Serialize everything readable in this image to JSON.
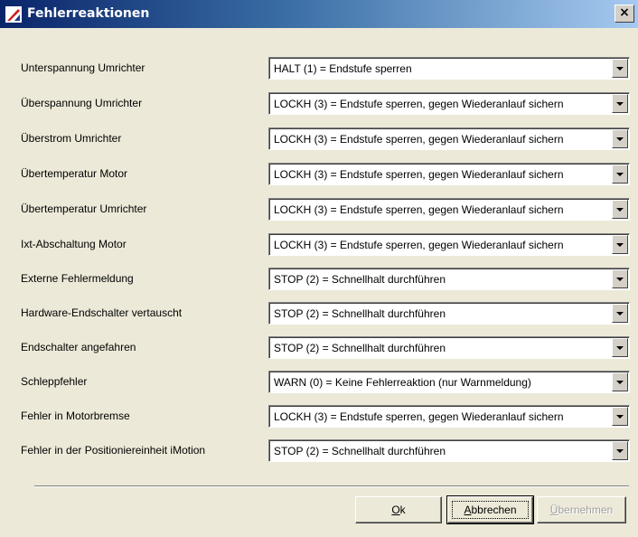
{
  "window": {
    "title": "Fehlerreaktionen",
    "close_label": "×"
  },
  "rows": [
    {
      "label": "Unterspannung Umrichter",
      "value": "HALT (1) = Endstufe sperren"
    },
    {
      "label": "Überspannung Umrichter",
      "value": "LOCKH (3) = Endstufe sperren, gegen Wiederanlauf sichern"
    },
    {
      "label": "Überstrom Umrichter",
      "value": "LOCKH (3) = Endstufe sperren, gegen Wiederanlauf sichern"
    },
    {
      "label": "Übertemperatur Motor",
      "value": "LOCKH (3) = Endstufe sperren, gegen Wiederanlauf sichern"
    },
    {
      "label": "Übertemperatur Umrichter",
      "value": "LOCKH (3) = Endstufe sperren, gegen Wiederanlauf sichern"
    },
    {
      "label": "Ixt-Abschaltung Motor",
      "value": "LOCKH (3) = Endstufe sperren, gegen Wiederanlauf sichern"
    },
    {
      "label": "Externe Fehlermeldung",
      "value": "STOP (2) = Schnellhalt durchführen"
    },
    {
      "label": "Hardware-Endschalter vertauscht",
      "value": "STOP (2) = Schnellhalt durchführen"
    },
    {
      "label": "Endschalter angefahren",
      "value": "STOP (2) = Schnellhalt durchführen"
    },
    {
      "label": "Schleppfehler",
      "value": "WARN (0) = Keine Fehlerreaktion (nur Warnmeldung)"
    },
    {
      "label": "Fehler in Motorbremse",
      "value": "LOCKH (3) = Endstufe sperren, gegen Wiederanlauf sichern"
    },
    {
      "label": "Fehler in der Positioniereinheit iMotion",
      "value": "STOP (2) = Schnellhalt durchführen"
    }
  ],
  "buttons": {
    "ok_mnemonic": "O",
    "ok_rest": "k",
    "cancel_mnemonic": "A",
    "cancel_rest": "bbrechen",
    "apply_mnemonic": "Ü",
    "apply_rest": "bernehmen"
  },
  "colors": {
    "title_gradient_start": "#0a246a",
    "title_gradient_end": "#a6caf0",
    "dialog_background": "#ece9d8"
  },
  "icons": {
    "app_icon": "app-logo-icon",
    "dropdown": "chevron-down-icon",
    "close": "close-icon"
  }
}
